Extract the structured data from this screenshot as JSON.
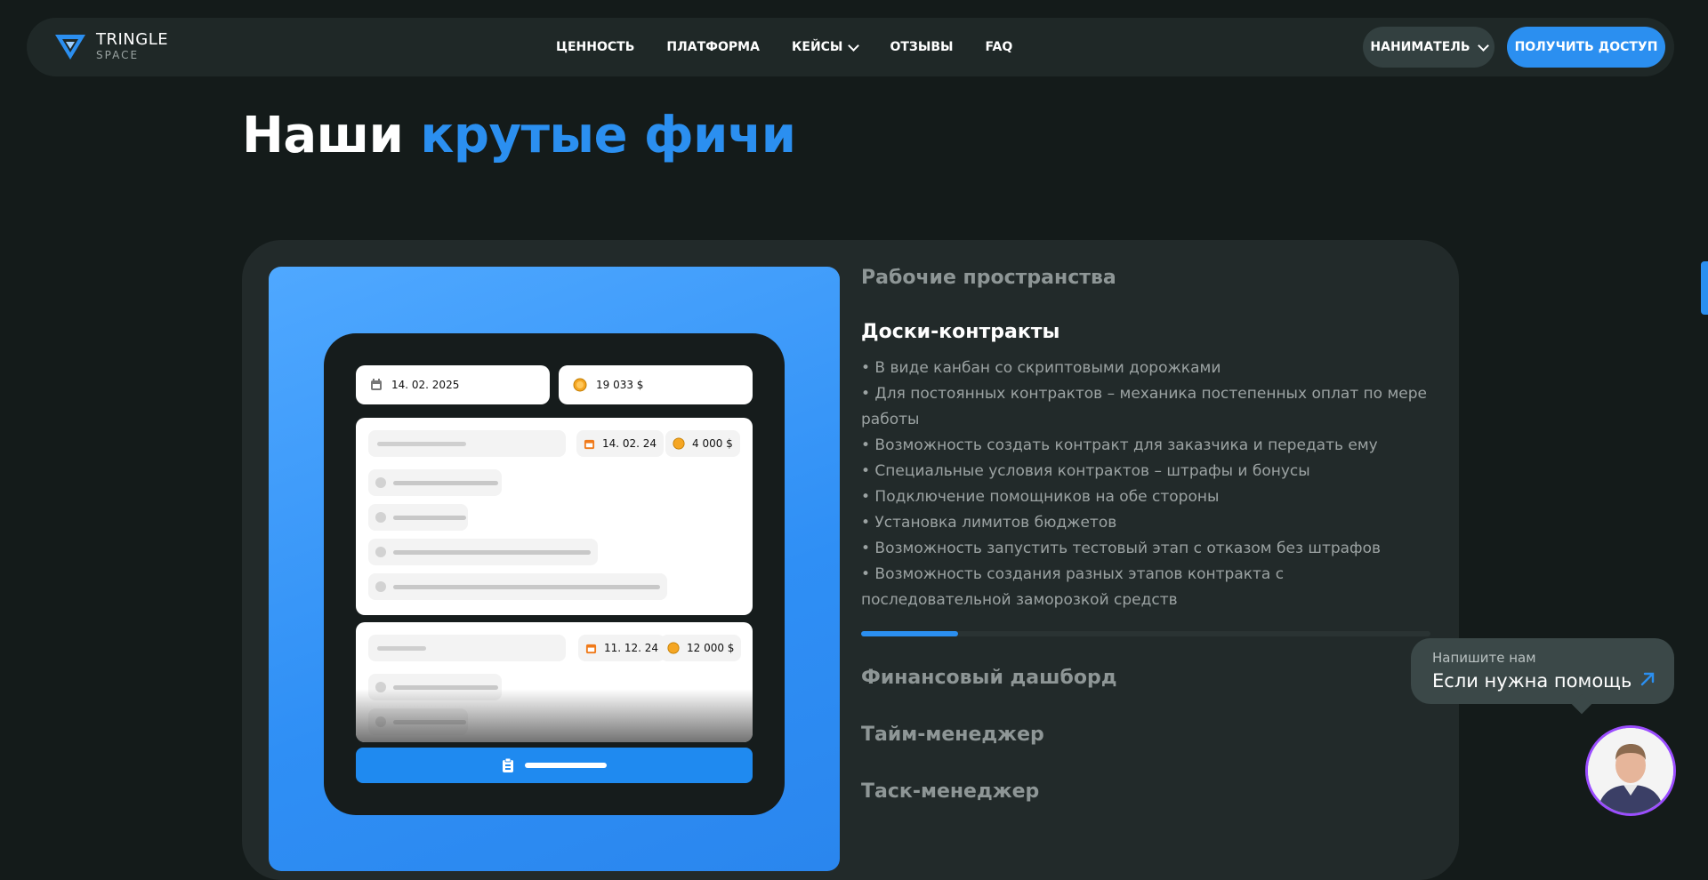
{
  "header": {
    "logo": {
      "line1": "TRINGLE",
      "line2": "SPACE"
    },
    "nav": [
      {
        "label": "ЦЕННОСТЬ"
      },
      {
        "label": "ПЛАТФОРМА"
      },
      {
        "label": "КЕЙСЫ"
      },
      {
        "label": "ОТЗЫВЫ"
      },
      {
        "label": "FAQ"
      }
    ],
    "employer_label": "НАНИМАТЕЛЬ",
    "cta_label": "ПОЛУЧИТЬ ДОСТУП"
  },
  "page_title": {
    "part1": "Наши ",
    "accent": "крутые фичи"
  },
  "preview": {
    "date_pill": "14. 02. 2025",
    "amount_pill": "19 033 $",
    "board1": {
      "date": "14. 02. 24",
      "amount": "4 000 $"
    },
    "board2": {
      "date": "11. 12. 24",
      "amount": "12 000 $"
    }
  },
  "features": {
    "items": [
      {
        "label": "Рабочие пространства"
      },
      {
        "label": "Доски-контракты"
      },
      {
        "label": "Финансовый дашборд"
      },
      {
        "label": "Тайм-менеджер"
      },
      {
        "label": "Таск-менеджер"
      }
    ],
    "active_description": [
      "• В виде канбан со скриптовыми дорожками",
      "• Для постоянных контрактов – механика постепенных оплат по мере работы",
      "• Возможность создать контракт для заказчика и передать ему",
      "• Специальные условия контрактов – штрафы и бонусы",
      "• Подключение помощников на обе стороны",
      "• Установка лимитов бюджетов",
      "• Возможность запустить тестовый этап с отказом без штрафов",
      "• Возможность создания разных этапов контракта с последовательной заморозкой средств"
    ],
    "progress_fraction": 0.17
  },
  "help": {
    "small": "Напишите нам",
    "big": "Если нужна помощь"
  },
  "colors": {
    "accent": "#2b8ff0",
    "background": "#141b1a",
    "card": "#222a2a"
  }
}
